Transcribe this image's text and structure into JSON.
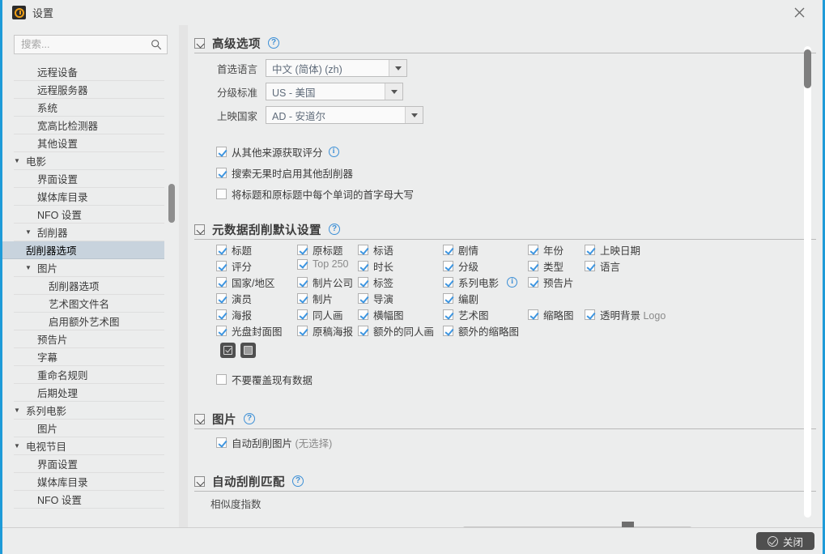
{
  "window": {
    "title": "设置",
    "app_icon": "tinymediamanager-icon",
    "close_icon": "close-icon"
  },
  "sidebar": {
    "search": {
      "placeholder": "搜索...",
      "value": "",
      "icon": "search-icon"
    },
    "items": [
      {
        "label": "远程设备",
        "level": 1,
        "caret": "",
        "selected": false
      },
      {
        "label": "远程服务器",
        "level": 1,
        "caret": "",
        "selected": false
      },
      {
        "label": "系统",
        "level": 1,
        "caret": "",
        "selected": false
      },
      {
        "label": "宽高比检测器",
        "level": 1,
        "caret": "",
        "selected": false
      },
      {
        "label": "其他设置",
        "level": 1,
        "caret": "",
        "selected": false
      },
      {
        "label": "电影",
        "level": 0,
        "caret": "▼",
        "selected": false
      },
      {
        "label": "界面设置",
        "level": 1,
        "caret": "",
        "selected": false
      },
      {
        "label": "媒体库目录",
        "level": 1,
        "caret": "",
        "selected": false
      },
      {
        "label": "NFO 设置",
        "level": 1,
        "caret": "",
        "selected": false
      },
      {
        "label": "刮削器",
        "level": 1,
        "caret": "▼",
        "selected": false
      },
      {
        "label": "刮削器选项",
        "level": 2,
        "caret": "",
        "selected": true
      },
      {
        "label": "图片",
        "level": 1,
        "caret": "▼",
        "selected": false
      },
      {
        "label": "刮削器选项",
        "level": 2,
        "caret": "",
        "selected": false
      },
      {
        "label": "艺术图文件名",
        "level": 2,
        "caret": "",
        "selected": false
      },
      {
        "label": "启用额外艺术图",
        "level": 2,
        "caret": "",
        "selected": false
      },
      {
        "label": "预告片",
        "level": 1,
        "caret": "",
        "selected": false
      },
      {
        "label": "字幕",
        "level": 1,
        "caret": "",
        "selected": false
      },
      {
        "label": "重命名规则",
        "level": 1,
        "caret": "",
        "selected": false
      },
      {
        "label": "后期处理",
        "level": 1,
        "caret": "",
        "selected": false
      },
      {
        "label": "系列电影",
        "level": 0,
        "caret": "▼",
        "selected": false
      },
      {
        "label": "图片",
        "level": 1,
        "caret": "",
        "selected": false
      },
      {
        "label": "电视节目",
        "level": 0,
        "caret": "▼",
        "selected": false
      },
      {
        "label": "界面设置",
        "level": 1,
        "caret": "",
        "selected": false
      },
      {
        "label": "媒体库目录",
        "level": 1,
        "caret": "",
        "selected": false
      },
      {
        "label": "NFO 设置",
        "level": 1,
        "caret": "",
        "selected": false
      }
    ]
  },
  "main": {
    "advanced": {
      "title": "高级选项",
      "help_icon": "help-icon",
      "fields": [
        {
          "label": "首选语言",
          "value": "中文 (简体) (zh)"
        },
        {
          "label": "分级标准",
          "value": "US - 美国"
        },
        {
          "label": "上映国家",
          "value": "AD - 安道尔"
        }
      ],
      "checkboxes": [
        {
          "label": "从其他来源获取评分",
          "checked": true,
          "info": true
        },
        {
          "label": "搜索无果时启用其他刮削器",
          "checked": true,
          "info": false
        },
        {
          "label": "将标题和原标题中每个单词的首字母大写",
          "checked": false,
          "info": false
        }
      ]
    },
    "metadata": {
      "title": "元数据刮削默认设置",
      "help_icon": "help-icon",
      "grid": [
        [
          {
            "label": "标题",
            "checked": true
          },
          {
            "label": "原标题",
            "checked": true
          },
          {
            "label": "标语",
            "checked": true
          },
          {
            "label": "剧情",
            "checked": true
          },
          {
            "label": "年份",
            "checked": true
          },
          {
            "label": "上映日期",
            "checked": true
          }
        ],
        [
          {
            "label": "评分",
            "checked": true
          },
          {
            "label": "Top 250",
            "checked": true,
            "dim": true
          },
          {
            "label": "时长",
            "checked": true
          },
          {
            "label": "分级",
            "checked": true
          },
          {
            "label": "类型",
            "checked": true
          },
          {
            "label": "语言",
            "checked": true
          }
        ],
        [
          {
            "label": "国家/地区",
            "checked": true
          },
          {
            "label": "制片公司",
            "checked": true
          },
          {
            "label": "标签",
            "checked": true
          },
          {
            "label": "系列电影",
            "checked": true,
            "info": true
          },
          {
            "label": "预告片",
            "checked": true
          },
          {
            "label": "",
            "checked": null
          }
        ],
        [
          {
            "label": "演员",
            "checked": true
          },
          {
            "label": "制片",
            "checked": true
          },
          {
            "label": "导演",
            "checked": true
          },
          {
            "label": "编剧",
            "checked": true
          },
          {
            "label": "",
            "checked": null
          },
          {
            "label": "",
            "checked": null
          }
        ],
        [
          {
            "label": "海报",
            "checked": true
          },
          {
            "label": "同人画",
            "checked": true
          },
          {
            "label": "横幅图",
            "checked": true
          },
          {
            "label": "艺术图",
            "checked": true
          },
          {
            "label": "缩略图",
            "checked": true
          },
          {
            "label": "透明背景 Logo",
            "checked": true,
            "dim_tail": "Logo"
          }
        ],
        [
          {
            "label": "光盘封面图",
            "checked": true
          },
          {
            "label": "原稿海报",
            "checked": true
          },
          {
            "label": "额外的同人画",
            "checked": true
          },
          {
            "label": "额外的缩略图",
            "checked": true
          },
          {
            "label": "",
            "checked": null
          },
          {
            "label": "",
            "checked": null
          }
        ]
      ],
      "select_all_icon": "select-all-icon",
      "deselect_all_icon": "deselect-all-icon",
      "no_overwrite": {
        "label": "不要覆盖现有数据",
        "checked": false
      }
    },
    "images": {
      "title": "图片",
      "help_icon": "help-icon",
      "checkbox": {
        "label": "自动刮削图片",
        "suffix": "(无选择)",
        "checked": true
      }
    },
    "automatch": {
      "title": "自动刮削匹配",
      "help_icon": "help-icon",
      "slider_label": "相似度指数",
      "slider_value": 72,
      "slider_min": 0,
      "slider_max": 100,
      "tick_count": 19
    },
    "scrollbar": {
      "name": "main-vertical-scrollbar"
    }
  },
  "bottom": {
    "close_label": "关闭",
    "close_icon": "check-circle-icon"
  }
}
